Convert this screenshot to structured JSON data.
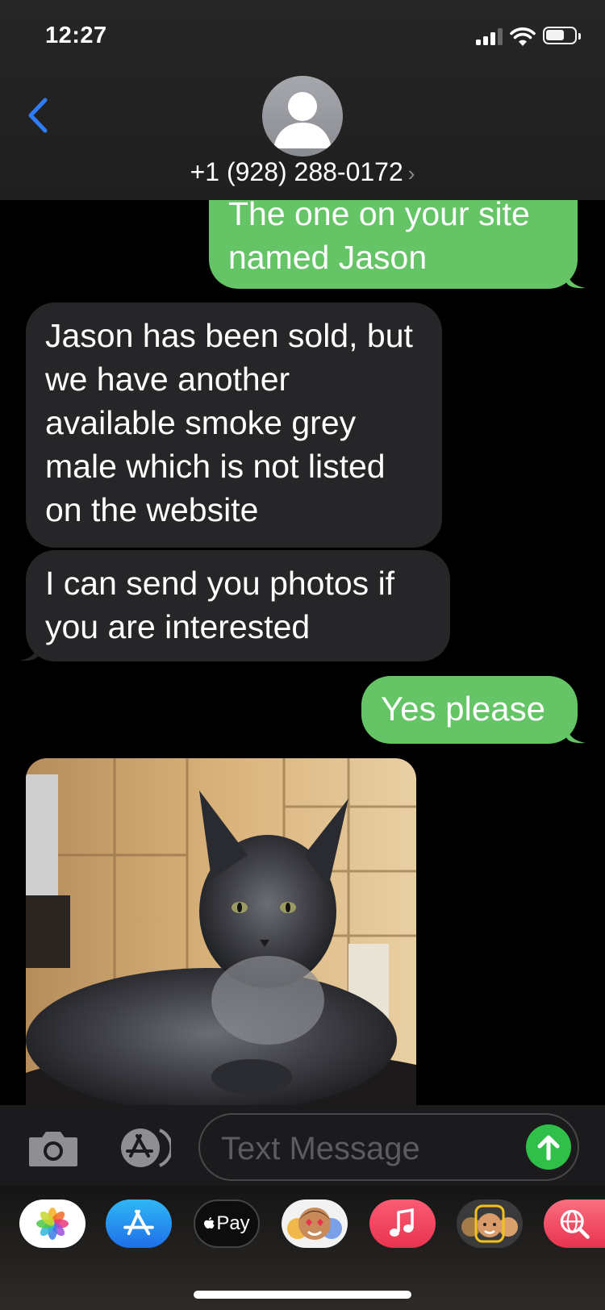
{
  "status_bar": {
    "time": "12:27"
  },
  "header": {
    "contact": "+1 (928) 288-0172",
    "chevron": "›",
    "back_icon": "chevron-left-icon",
    "avatar_icon": "person-icon"
  },
  "messages": [
    {
      "side": "sent",
      "text": "The one on your site named Jason"
    },
    {
      "side": "received",
      "text": "Jason has been sold, but we have another available smoke grey male which is not listed on the website"
    },
    {
      "side": "received",
      "text": "I can send you photos if you are interested"
    },
    {
      "side": "sent",
      "text": "Yes please"
    },
    {
      "side": "received",
      "type": "photo",
      "subject": "smoke grey kitten"
    }
  ],
  "composer": {
    "placeholder": "Text Message",
    "camera_icon": "camera-icon",
    "apps_icon": "app-store-icon",
    "send_icon": "arrow-up-icon"
  },
  "app_drawer": {
    "apps": [
      "Photos",
      "App Store",
      "Pay",
      "Memoji Stickers",
      "Music",
      "Memoji",
      "Search"
    ],
    "pay_label": "Pay"
  },
  "colors": {
    "sent_bubble": "#65c466",
    "received_bubble": "#262628",
    "accent": "#2f7cf6",
    "send_button": "#30c049"
  }
}
